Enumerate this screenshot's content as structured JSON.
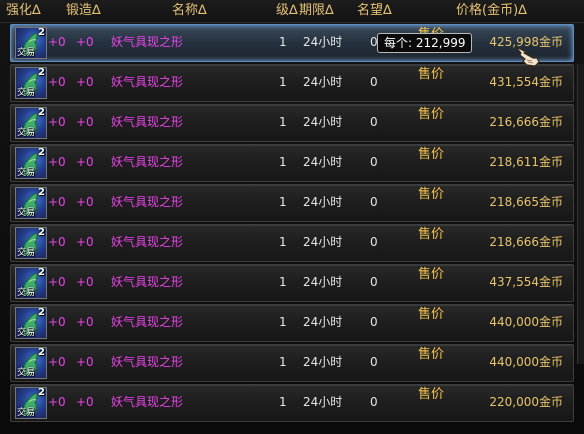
{
  "columns": {
    "enhance": "强化",
    "forge": "锻造",
    "name": "名称",
    "level": "级",
    "duration": "期限",
    "fame": "名望",
    "price": "价格(金币)",
    "sort_glyph": "∆"
  },
  "tooltip": "每个: 212,999",
  "icon_name": "dragon-statue-icon",
  "colors": {
    "accent": "#e3c074",
    "item_name": "#e844e8",
    "sell": "#f3c44a",
    "selected_border": "#5d8fc5"
  },
  "rows": [
    {
      "badge": "2",
      "trade": "交易",
      "enhance": "+0",
      "forge": "+0",
      "name": "妖气具现之形",
      "level": "1",
      "duration": "24小时",
      "fame": "0",
      "sell": "售价",
      "price": "425,998金币"
    },
    {
      "badge": "2",
      "trade": "交易",
      "enhance": "+0",
      "forge": "+0",
      "name": "妖气具现之形",
      "level": "1",
      "duration": "24小时",
      "fame": "0",
      "sell": "售价",
      "price": "431,554金币"
    },
    {
      "badge": "2",
      "trade": "交易",
      "enhance": "+0",
      "forge": "+0",
      "name": "妖气具现之形",
      "level": "1",
      "duration": "24小时",
      "fame": "0",
      "sell": "售价",
      "price": "216,666金币"
    },
    {
      "badge": "2",
      "trade": "交易",
      "enhance": "+0",
      "forge": "+0",
      "name": "妖气具现之形",
      "level": "1",
      "duration": "24小时",
      "fame": "0",
      "sell": "售价",
      "price": "218,611金币"
    },
    {
      "badge": "2",
      "trade": "交易",
      "enhance": "+0",
      "forge": "+0",
      "name": "妖气具现之形",
      "level": "1",
      "duration": "24小时",
      "fame": "0",
      "sell": "售价",
      "price": "218,665金币"
    },
    {
      "badge": "2",
      "trade": "交易",
      "enhance": "+0",
      "forge": "+0",
      "name": "妖气具现之形",
      "level": "1",
      "duration": "24小时",
      "fame": "0",
      "sell": "售价",
      "price": "218,666金币"
    },
    {
      "badge": "2",
      "trade": "交易",
      "enhance": "+0",
      "forge": "+0",
      "name": "妖气具现之形",
      "level": "1",
      "duration": "24小时",
      "fame": "0",
      "sell": "售价",
      "price": "437,554金币"
    },
    {
      "badge": "2",
      "trade": "交易",
      "enhance": "+0",
      "forge": "+0",
      "name": "妖气具现之形",
      "level": "1",
      "duration": "24小时",
      "fame": "0",
      "sell": "售价",
      "price": "440,000金币"
    },
    {
      "badge": "2",
      "trade": "交易",
      "enhance": "+0",
      "forge": "+0",
      "name": "妖气具现之形",
      "level": "1",
      "duration": "24小时",
      "fame": "0",
      "sell": "售价",
      "price": "440,000金币"
    },
    {
      "badge": "2",
      "trade": "交易",
      "enhance": "+0",
      "forge": "+0",
      "name": "妖气具现之形",
      "level": "1",
      "duration": "24小时",
      "fame": "0",
      "sell": "售价",
      "price": "220,000金币"
    }
  ]
}
